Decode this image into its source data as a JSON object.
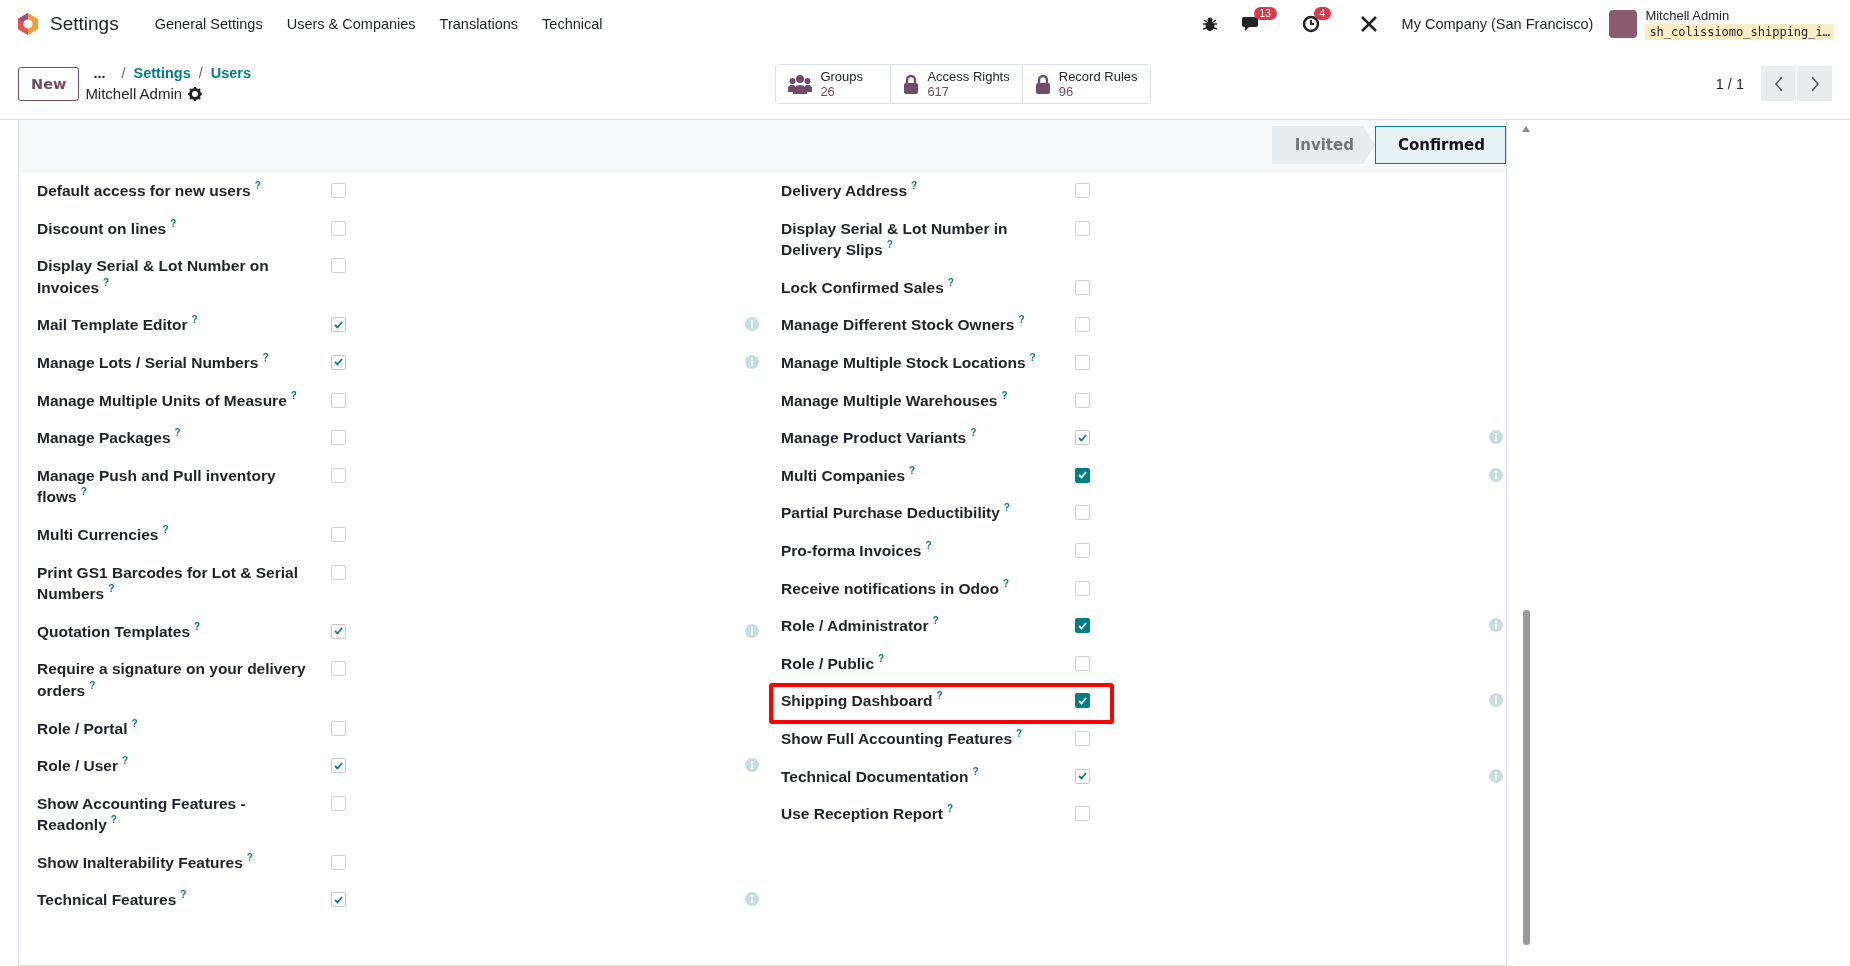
{
  "navbar": {
    "app_name": "Settings",
    "menu": [
      "General Settings",
      "Users & Companies",
      "Translations",
      "Technical"
    ],
    "messages_badge": "13",
    "activities_badge": "4",
    "company": "My Company (San Francisco)",
    "user_name": "Mitchell Admin",
    "database": "sh_colissiomo_shipping_i…"
  },
  "control_panel": {
    "new_button": "New",
    "breadcrumb_more": "...",
    "breadcrumbs": [
      {
        "separator": "/",
        "label": "Settings"
      },
      {
        "separator": "/",
        "label": "Users"
      }
    ],
    "record_title": "Mitchell Admin",
    "smart_buttons": [
      {
        "label": "Groups",
        "count": "26",
        "kind": "group"
      },
      {
        "label": "Access Rights",
        "count": "617",
        "kind": "access"
      },
      {
        "label": "Record Rules",
        "count": "96",
        "kind": "rule"
      }
    ],
    "pager": "1 / 1"
  },
  "status_bar": [
    {
      "label": "Invited",
      "selected": false
    },
    {
      "label": "Confirmed",
      "selected": true
    }
  ],
  "columns": [
    [
      {
        "label": "Default access for new users",
        "help": "?",
        "checked": false,
        "kind": "editable",
        "highlighted": false
      },
      {
        "label": "Discount on lines",
        "help": "?",
        "checked": false,
        "kind": "editable",
        "highlighted": false
      },
      {
        "label": "Display Serial & Lot Number on Invoices",
        "help": "?",
        "checked": false,
        "kind": "editable",
        "highlighted": false
      },
      {
        "label": "Mail Template Editor",
        "help": "?",
        "checked": true,
        "kind": "readonly",
        "highlighted": false
      },
      {
        "label": "Manage Lots / Serial Numbers",
        "help": "?",
        "checked": true,
        "kind": "readonly",
        "highlighted": false
      },
      {
        "label": "Manage Multiple Units of Measure",
        "help": "?",
        "checked": false,
        "kind": "editable",
        "highlighted": false
      },
      {
        "label": "Manage Packages",
        "help": "?",
        "checked": false,
        "kind": "editable",
        "highlighted": false
      },
      {
        "label": "Manage Push and Pull inventory flows",
        "help": "?",
        "checked": false,
        "kind": "editable",
        "highlighted": false
      },
      {
        "label": "Multi Currencies",
        "help": "?",
        "checked": false,
        "kind": "editable",
        "highlighted": false
      },
      {
        "label": "Print GS1 Barcodes for Lot & Serial Numbers",
        "help": "?",
        "checked": false,
        "kind": "editable",
        "highlighted": false
      },
      {
        "label": "Quotation Templates",
        "help": "?",
        "checked": true,
        "kind": "readonly",
        "highlighted": false
      },
      {
        "label": "Require a signature on your delivery orders",
        "help": "?",
        "checked": false,
        "kind": "editable",
        "highlighted": false
      },
      {
        "label": "Role / Portal",
        "help": "?",
        "checked": false,
        "kind": "editable",
        "highlighted": false
      },
      {
        "label": "Role / User",
        "help": "?",
        "checked": true,
        "kind": "readonly",
        "highlighted": false
      },
      {
        "label": "Show Accounting Features - Readonly",
        "help": "?",
        "checked": false,
        "kind": "editable",
        "highlighted": false
      },
      {
        "label": "Show Inalterability Features",
        "help": "?",
        "checked": false,
        "kind": "editable",
        "highlighted": false
      },
      {
        "label": "Technical Features",
        "help": "?",
        "checked": true,
        "kind": "readonly",
        "highlighted": false
      }
    ],
    [
      {
        "label": "Delivery Address",
        "help": "?",
        "checked": false,
        "kind": "editable",
        "highlighted": false
      },
      {
        "label": "Display Serial & Lot Number in Delivery Slips",
        "help": "?",
        "checked": false,
        "kind": "editable",
        "highlighted": false
      },
      {
        "label": "Lock Confirmed Sales",
        "help": "?",
        "checked": false,
        "kind": "editable",
        "highlighted": false
      },
      {
        "label": "Manage Different Stock Owners",
        "help": "?",
        "checked": false,
        "kind": "editable",
        "highlighted": false
      },
      {
        "label": "Manage Multiple Stock Locations",
        "help": "?",
        "checked": false,
        "kind": "editable",
        "highlighted": false
      },
      {
        "label": "Manage Multiple Warehouses",
        "help": "?",
        "checked": false,
        "kind": "editable",
        "highlighted": false
      },
      {
        "label": "Manage Product Variants",
        "help": "?",
        "checked": true,
        "kind": "readonly",
        "highlighted": false
      },
      {
        "label": "Multi Companies",
        "help": "?",
        "checked": true,
        "kind": "editable",
        "highlighted": false
      },
      {
        "label": "Partial Purchase Deductibility",
        "help": "?",
        "checked": false,
        "kind": "editable",
        "highlighted": false
      },
      {
        "label": "Pro-forma Invoices",
        "help": "?",
        "checked": false,
        "kind": "editable",
        "highlighted": false
      },
      {
        "label": "Receive notifications in Odoo",
        "help": "?",
        "checked": false,
        "kind": "editable",
        "highlighted": false
      },
      {
        "label": "Role / Administrator",
        "help": "?",
        "checked": true,
        "kind": "editable",
        "highlighted": false
      },
      {
        "label": "Role / Public",
        "help": "?",
        "checked": false,
        "kind": "editable",
        "highlighted": false
      },
      {
        "label": "Shipping Dashboard",
        "help": "?",
        "checked": true,
        "kind": "editable",
        "highlighted": true
      },
      {
        "label": "Show Full Accounting Features",
        "help": "?",
        "checked": false,
        "kind": "editable",
        "highlighted": false
      },
      {
        "label": "Technical Documentation",
        "help": "?",
        "checked": true,
        "kind": "readonly",
        "highlighted": false
      },
      {
        "label": "Use Reception Report",
        "help": "?",
        "checked": false,
        "kind": "editable",
        "highlighted": false
      }
    ]
  ]
}
